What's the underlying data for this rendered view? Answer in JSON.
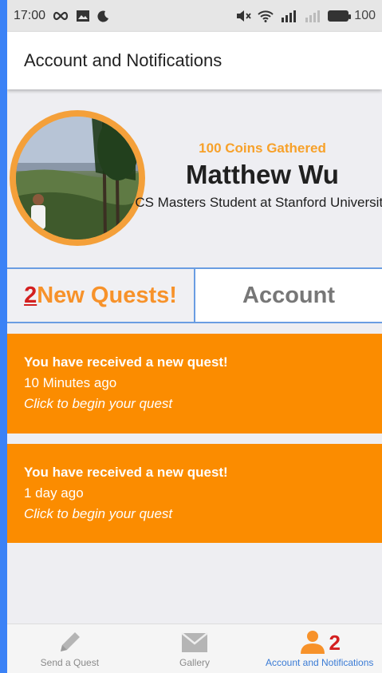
{
  "status_bar": {
    "time": "17:00",
    "battery": "100"
  },
  "app_bar": {
    "title": "Account and Notifications"
  },
  "profile": {
    "coins": "100 Coins Gathered",
    "name": "Matthew Wu",
    "title": "CS Masters Student at Stanford University"
  },
  "tabs": {
    "new_count": "2",
    "new_label": "New Quests!",
    "account_label": "Account"
  },
  "quests": [
    {
      "title": "You have received a new quest!",
      "time": "10 Minutes ago",
      "hint": "Click to begin your quest"
    },
    {
      "title": "You have received a new quest!",
      "time": "1 day ago",
      "hint": "Click to begin your quest"
    }
  ],
  "bottom_nav": {
    "items": [
      {
        "label": "Send a Quest",
        "icon": "pencil-icon"
      },
      {
        "label": "Gallery",
        "icon": "envelope-icon"
      },
      {
        "label": "Account and Notifications",
        "icon": "person-icon",
        "badge": "2"
      }
    ]
  },
  "colors": {
    "accent_orange": "#fb8c00",
    "coin_orange": "#f7a12a",
    "badge_red": "#d32020",
    "active_blue": "#3a7bd5"
  }
}
